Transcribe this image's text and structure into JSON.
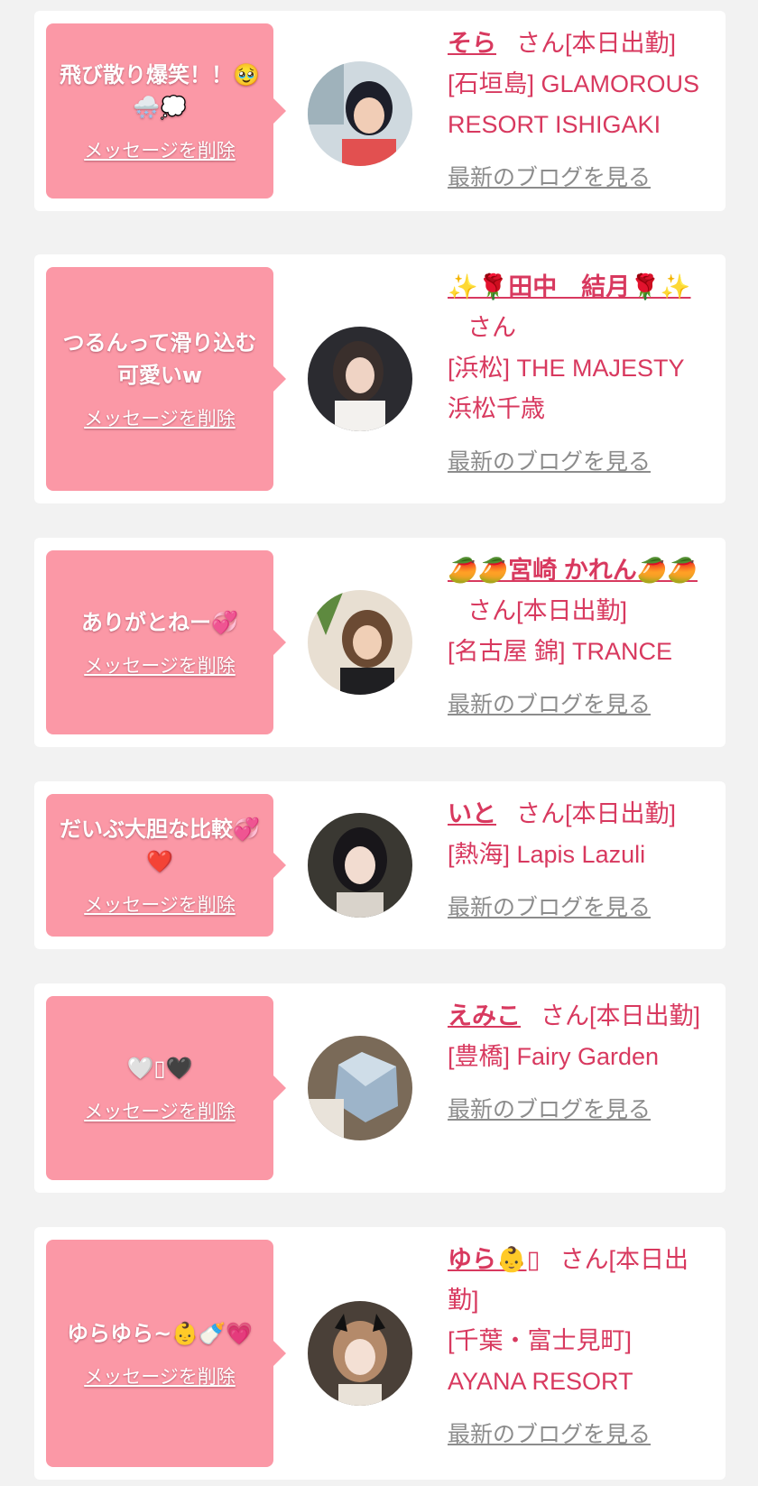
{
  "colors": {
    "accent": "#d8395f",
    "bubble": "#fb98a6",
    "link_gray": "#8c8c8c",
    "background": "#f2f2f2"
  },
  "cards": [
    {
      "message": "飛び散り爆笑！！🥹🌨️💭",
      "delete_label": "メッセージを削除",
      "avatar_icon": "avatar-photo",
      "name": "そら",
      "san": "さん[本日出勤]",
      "shop": "[石垣島] GLAMOROUS RESORT ISHIGAKI",
      "blog_label": "最新のブログを見る"
    },
    {
      "message": "つるんって滑り込む可愛いw",
      "delete_label": "メッセージを削除",
      "avatar_icon": "avatar-photo",
      "name": "✨🌹田中　結月🌹✨",
      "san": "さん",
      "shop": "[浜松] THE MAJESTY 浜松千歳",
      "blog_label": "最新のブログを見る"
    },
    {
      "message": "ありがとねー💞",
      "delete_label": "メッセージを削除",
      "avatar_icon": "avatar-photo",
      "name": "🥭🥭宮崎 かれん🥭🥭",
      "san": "さん[本日出勤]",
      "shop": "[名古屋 錦] TRANCE",
      "blog_label": "最新のブログを見る"
    },
    {
      "message": "だいぶ大胆な比較💞❤️",
      "delete_label": "メッセージを削除",
      "avatar_icon": "avatar-photo",
      "name": "いと",
      "san": "さん[本日出勤]",
      "shop": "[熱海] Lapis Lazuli",
      "blog_label": "最新のブログを見る"
    },
    {
      "message": "🤍▯🖤",
      "delete_label": "メッセージを削除",
      "avatar_icon": "avatar-photo",
      "name": "えみこ",
      "san": "さん[本日出勤]",
      "shop": "[豊橋] Fairy Garden",
      "blog_label": "最新のブログを見る"
    },
    {
      "message": "ゆらゆら~👶🍼💗",
      "delete_label": "メッセージを削除",
      "avatar_icon": "avatar-photo",
      "name": "ゆら👶▯",
      "san": "さん[本日出勤]",
      "shop": "[千葉・富士見町] AYANA RESORT",
      "blog_label": "最新のブログを見る"
    }
  ]
}
